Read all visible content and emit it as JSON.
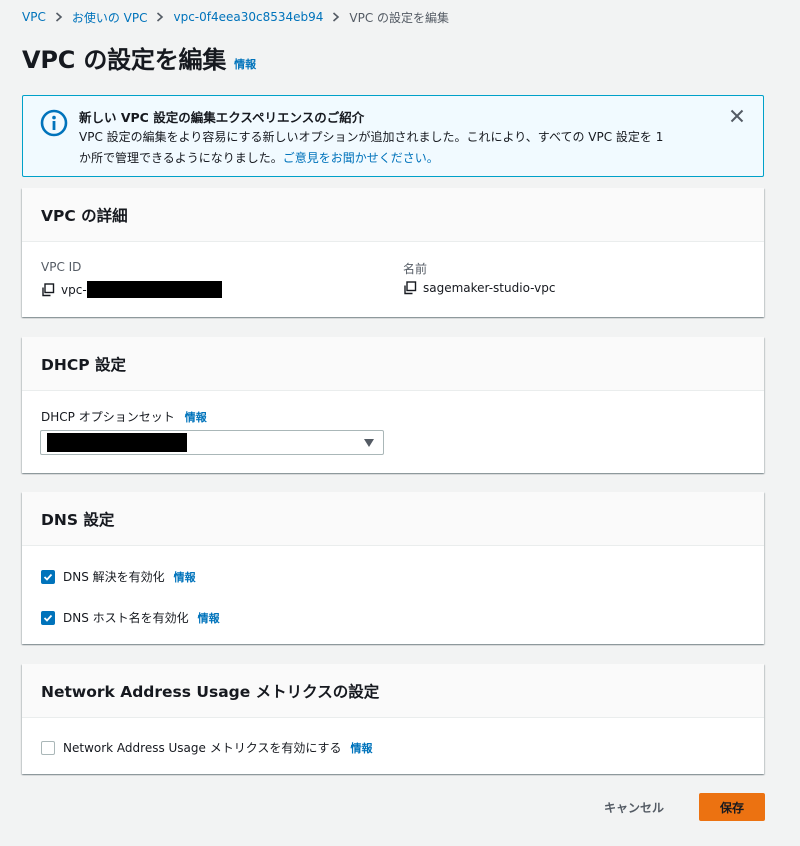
{
  "breadcrumb": {
    "items": [
      "VPC",
      "お使いの VPC",
      "vpc-0f4eea30c8534eb94"
    ],
    "current": "VPC の設定を編集"
  },
  "header": {
    "title": "VPC の設定を編集",
    "info": "情報"
  },
  "flash": {
    "title": "新しい VPC 設定の編集エクスペリエンスのご紹介",
    "body_line1": "VPC 設定の編集をより容易にする新しいオプションが追加されました。これにより、すべての VPC 設定を 1",
    "body_line2": "か所で管理できるようになりました。",
    "feedback_link": "ご意見をお聞かせください。",
    "icon": "info-icon",
    "close_icon": "close-icon",
    "colors": {
      "background": "#f1faff",
      "border": "#00a1c9",
      "icon": "#0073bb"
    }
  },
  "vpc_details": {
    "heading": "VPC の詳細",
    "vpc_id_label": "VPC ID",
    "vpc_id_value": "vpc-",
    "name_label": "名前",
    "name_value": "sagemaker-studio-vpc"
  },
  "dhcp": {
    "heading": "DHCP 設定",
    "option_set_label": "DHCP オプションセット",
    "info": "情報"
  },
  "dns": {
    "heading": "DNS 設定",
    "resolution_label": "DNS 解決を有効化",
    "resolution_checked": true,
    "hostnames_label": "DNS ホスト名を有効化",
    "hostnames_checked": true,
    "info": "情報"
  },
  "nau": {
    "heading": "Network Address Usage メトリクスの設定",
    "enable_label": "Network Address Usage メトリクスを有効にする",
    "enable_checked": false,
    "info": "情報"
  },
  "footer": {
    "cancel_label": "キャンセル",
    "save_label": "保存",
    "save_color": "#ec7211"
  }
}
